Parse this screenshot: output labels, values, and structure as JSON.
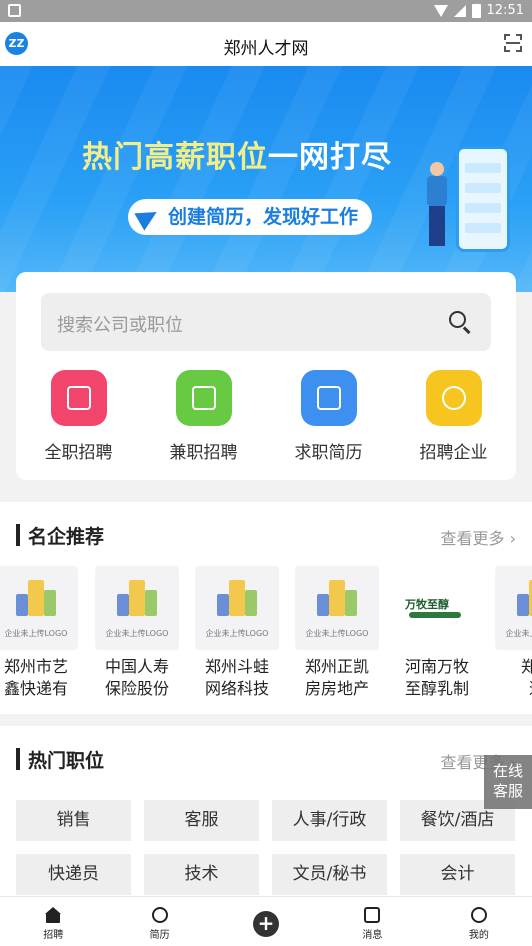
{
  "status_bar": {
    "time": "12:51"
  },
  "app_bar": {
    "logo_text": "ZZ",
    "title": "郑州人才网"
  },
  "banner": {
    "headline_a": "热门高薪职位",
    "headline_b": "一网打尽",
    "slogan": "创建简历，发现好工作"
  },
  "search": {
    "placeholder": "搜索公司或职位"
  },
  "categories": [
    {
      "label": "全职招聘",
      "color": "#f2456b",
      "icon": "briefcase-icon"
    },
    {
      "label": "兼职招聘",
      "color": "#68c943",
      "icon": "document-clock-icon"
    },
    {
      "label": "求职简历",
      "color": "#3d8ff0",
      "icon": "resume-icon"
    },
    {
      "label": "招聘企业",
      "color": "#f7c51f",
      "icon": "medal-icon"
    }
  ],
  "featured": {
    "title": "名企推荐",
    "more": "查看更多",
    "placeholder_caption": "企业未上传LOGO",
    "companies": [
      {
        "name": "郑州市艺\n鑫快递有"
      },
      {
        "name": "中国人寿\n保险股份"
      },
      {
        "name": "郑州斗蛙\n网络科技"
      },
      {
        "name": "郑州正凯\n房房地产"
      },
      {
        "name": "河南万牧\n至醇乳制",
        "logo_text": "万牧至醇"
      },
      {
        "name": "郑州\n逸"
      }
    ]
  },
  "hot_jobs": {
    "title": "热门职位",
    "more": "查看更多",
    "tags": [
      "销售",
      "客服",
      "人事/行政",
      "餐饮/酒店",
      "快递员",
      "技术",
      "文员/秘书",
      "会计"
    ]
  },
  "floating_service": {
    "line1": "在线",
    "line2": "客服"
  },
  "tab_bar": {
    "items": [
      {
        "label": "招聘",
        "icon": "home-icon"
      },
      {
        "label": "简历",
        "icon": "clock-icon"
      },
      {
        "label": "",
        "icon": "plus-icon"
      },
      {
        "label": "消息",
        "icon": "message-icon"
      },
      {
        "label": "我的",
        "icon": "smile-icon"
      }
    ]
  }
}
